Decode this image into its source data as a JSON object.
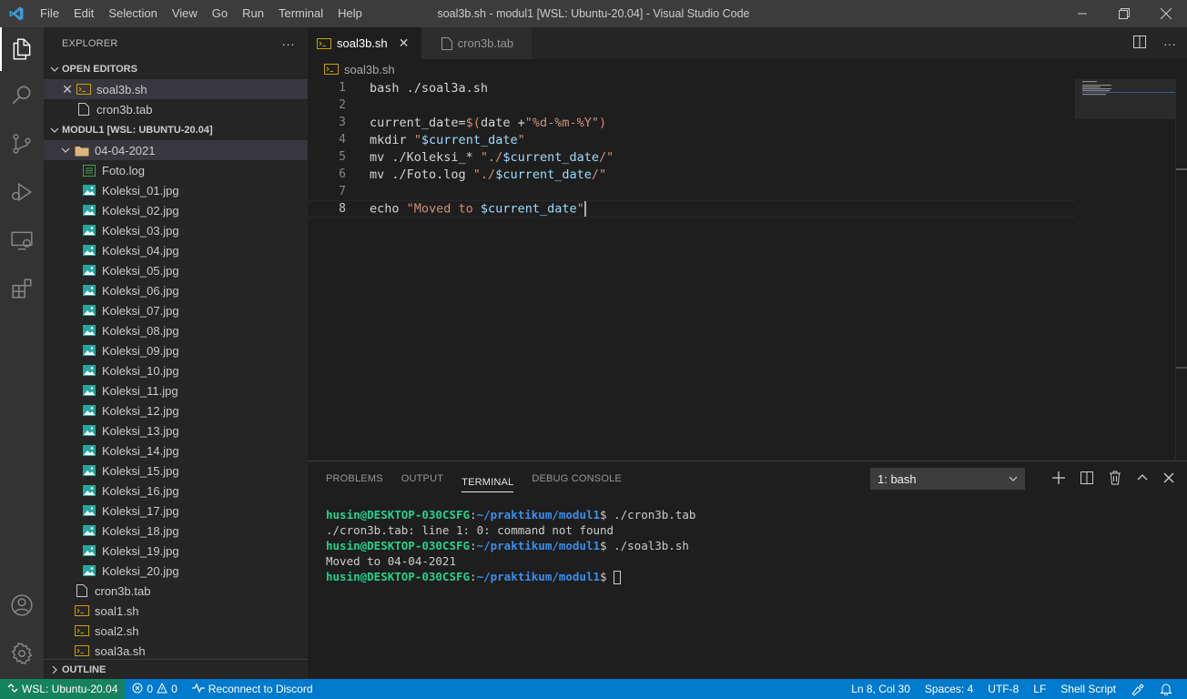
{
  "titlebar": {
    "menu": [
      "File",
      "Edit",
      "Selection",
      "View",
      "Go",
      "Run",
      "Terminal",
      "Help"
    ],
    "title": "soal3b.sh - modul1 [WSL: Ubuntu-20.04] - Visual Studio Code"
  },
  "activity_bar": [
    "explorer-icon",
    "search-icon",
    "source-control-icon",
    "run-debug-icon",
    "remote-explorer-icon",
    "extensions-icon",
    "account-icon",
    "settings-gear-icon"
  ],
  "sidebar": {
    "header": "EXPLORER",
    "more": "···",
    "open_editors": {
      "label": "OPEN EDITORS",
      "items": [
        {
          "name": "soal3b.sh",
          "type": "shell",
          "selected": true,
          "close": "✕"
        },
        {
          "name": "cron3b.tab",
          "type": "file"
        }
      ]
    },
    "workspace": {
      "label": "MODUL1 [WSL: UBUNTU-20.04]",
      "folder": "04-04-2021",
      "folder_items": [
        {
          "name": "Foto.log",
          "type": "log"
        },
        {
          "name": "Koleksi_01.jpg",
          "type": "image"
        },
        {
          "name": "Koleksi_02.jpg",
          "type": "image"
        },
        {
          "name": "Koleksi_03.jpg",
          "type": "image"
        },
        {
          "name": "Koleksi_04.jpg",
          "type": "image"
        },
        {
          "name": "Koleksi_05.jpg",
          "type": "image"
        },
        {
          "name": "Koleksi_06.jpg",
          "type": "image"
        },
        {
          "name": "Koleksi_07.jpg",
          "type": "image"
        },
        {
          "name": "Koleksi_08.jpg",
          "type": "image"
        },
        {
          "name": "Koleksi_09.jpg",
          "type": "image"
        },
        {
          "name": "Koleksi_10.jpg",
          "type": "image"
        },
        {
          "name": "Koleksi_11.jpg",
          "type": "image"
        },
        {
          "name": "Koleksi_12.jpg",
          "type": "image"
        },
        {
          "name": "Koleksi_13.jpg",
          "type": "image"
        },
        {
          "name": "Koleksi_14.jpg",
          "type": "image"
        },
        {
          "name": "Koleksi_15.jpg",
          "type": "image"
        },
        {
          "name": "Koleksi_16.jpg",
          "type": "image"
        },
        {
          "name": "Koleksi_17.jpg",
          "type": "image"
        },
        {
          "name": "Koleksi_18.jpg",
          "type": "image"
        },
        {
          "name": "Koleksi_19.jpg",
          "type": "image"
        },
        {
          "name": "Koleksi_20.jpg",
          "type": "image"
        }
      ],
      "root_items": [
        {
          "name": "cron3b.tab",
          "type": "file"
        },
        {
          "name": "soal1.sh",
          "type": "shell"
        },
        {
          "name": "soal2.sh",
          "type": "shell"
        },
        {
          "name": "soal3a.sh",
          "type": "shell"
        }
      ]
    },
    "outline": "OUTLINE"
  },
  "editor": {
    "tabs": [
      {
        "label": "soal3b.sh",
        "active": true,
        "close": "✕"
      },
      {
        "label": "cron3b.tab",
        "active": false
      }
    ],
    "breadcrumb": "soal3b.sh",
    "lines": [
      {
        "num": "1",
        "text": "bash ./soal3a.sh"
      },
      {
        "num": "2",
        "text": ""
      },
      {
        "num": "3",
        "text": "current_date=$(date +\"%d-%m-%Y\")"
      },
      {
        "num": "4",
        "text": "mkdir \"$current_date\""
      },
      {
        "num": "5",
        "text": "mv ./Koleksi_* \"./$current_date/\""
      },
      {
        "num": "6",
        "text": "mv ./Foto.log \"./$current_date/\""
      },
      {
        "num": "7",
        "text": ""
      },
      {
        "num": "8",
        "text": "echo \"Moved to $current_date\""
      }
    ],
    "current_line": 8
  },
  "panel": {
    "tabs": [
      "PROBLEMS",
      "OUTPUT",
      "TERMINAL",
      "DEBUG CONSOLE"
    ],
    "active_tab": "TERMINAL",
    "terminal_select": "1: bash",
    "terminal_lines": [
      {
        "user": "husin@DESKTOP-030CSFG",
        "sep": ":",
        "path": "~/praktikum/modul1",
        "cmd": "$ ./cron3b.tab"
      },
      {
        "output": "./cron3b.tab: line 1: 0: command not found"
      },
      {
        "user": "husin@DESKTOP-030CSFG",
        "sep": ":",
        "path": "~/praktikum/modul1",
        "cmd": "$ ./soal3b.sh"
      },
      {
        "output": "Moved to 04-04-2021"
      },
      {
        "user": "husin@DESKTOP-030CSFG",
        "sep": ":",
        "path": "~/praktikum/modul1",
        "cmd": "$ "
      }
    ]
  },
  "statusbar": {
    "remote": "WSL: Ubuntu-20.04",
    "errors": "0",
    "warnings": "0",
    "discord": "Reconnect to Discord",
    "position": "Ln 8, Col 30",
    "spaces": "Spaces: 4",
    "encoding": "UTF-8",
    "eol": "LF",
    "language": "Shell Script"
  },
  "colors": {
    "accent": "#007acc",
    "remote": "#16825d",
    "terminal_user": "#23d18b",
    "terminal_path": "#3b8eea",
    "string": "#ce9178",
    "variable": "#9cdcfe"
  }
}
